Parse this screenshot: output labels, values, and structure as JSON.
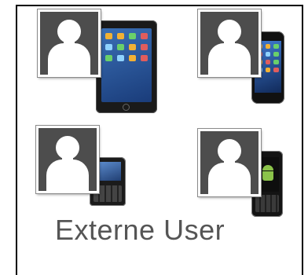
{
  "caption": "Externe User",
  "tiles": [
    {
      "device": "tablet-icon",
      "person": "user-silhouette-icon"
    },
    {
      "device": "smartphone-icon",
      "person": "user-silhouette-icon"
    },
    {
      "device": "blackberry-phone-icon",
      "person": "user-silhouette-icon"
    },
    {
      "device": "android-phone-icon",
      "person": "user-silhouette-icon"
    }
  ]
}
